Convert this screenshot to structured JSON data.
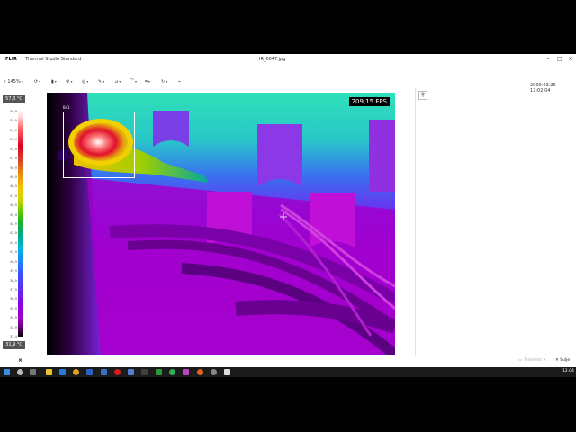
{
  "window": {
    "logo": "FLIR",
    "app_title": "Thermal Studio Standard",
    "document": "IR_0047.jpg",
    "controls": [
      "–",
      "□",
      "×"
    ]
  },
  "toolbar": {
    "zoom_label": "145%",
    "icons": [
      "zoom-icon",
      "rotate-icon",
      "palette-icon",
      "settings-icon",
      "pencil-icon",
      "measure-icon",
      "shape-icon",
      "crop-icon",
      "refresh-icon",
      "chart-icon"
    ]
  },
  "datetime": "2009.03.26 17:02:04",
  "scale": {
    "max_label": "57,3 °C",
    "min_label": "31,9 °C",
    "ticks": [
      "56,9",
      "55,9",
      "54,9",
      "53,9",
      "52,9",
      "51,9",
      "50,9",
      "49,9",
      "48,9",
      "47,9",
      "46,9",
      "45,9",
      "44,9",
      "43,9",
      "42,9",
      "41,9",
      "40,9",
      "39,9",
      "38,9",
      "37,9",
      "36,9",
      "35,9",
      "34,9",
      "33,9",
      "32,4"
    ]
  },
  "image": {
    "fps_label": "209,15 FPS",
    "roi_label": "Bx1"
  },
  "statusbar": {
    "telemetry_label": "Telemetri",
    "close_label": "Sulje"
  },
  "taskbar": {
    "clock": "12.04"
  }
}
